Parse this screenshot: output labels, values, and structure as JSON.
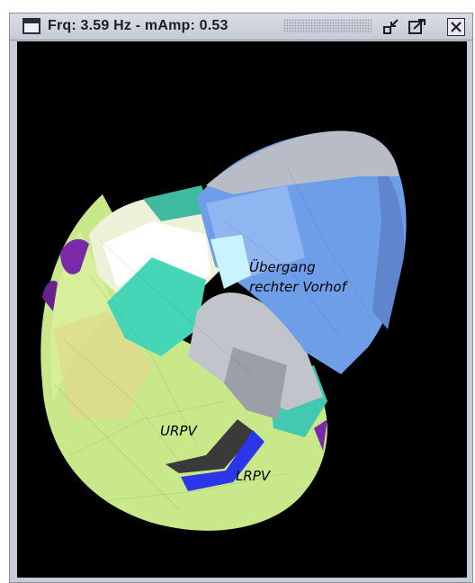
{
  "window": {
    "title": "Frq: 3.59 Hz - mAmp: 0.53",
    "icons": {
      "app": "window-menu-icon",
      "minimize": "minimize-icon",
      "maximize": "maximize-icon",
      "close": "close-icon"
    }
  },
  "viewport": {
    "background": "#000000",
    "labels": {
      "ubergang": "Übergang",
      "rechter_vorhof": "rechter Vorhof",
      "urpv": "URPV",
      "lrpv": "LRPV"
    }
  },
  "colors": {
    "blue_region": "#6f9ee8",
    "gray_region": "#c2c4cc",
    "yellow_green_region": "#c8e88a",
    "teal_region": "#45d6b8",
    "purple_region": "#7a2aa8",
    "vein_blue": "#2a36e8",
    "vein_dark": "#3a3a3a"
  }
}
